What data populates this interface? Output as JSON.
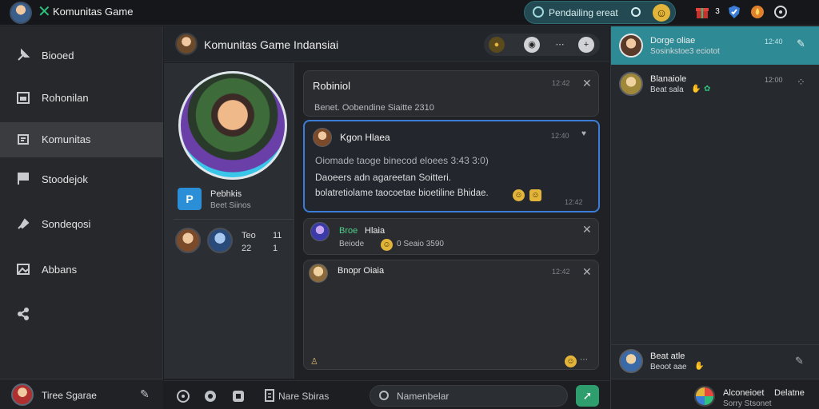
{
  "app": {
    "title": "Komunitas Game"
  },
  "topbar": {
    "search_text": "Pendailing ereat",
    "icons": [
      "avatar-icon",
      "x-logo-icon",
      "search-icon",
      "emoji-icon",
      "gift-icon",
      "notification-count-icon",
      "shield-icon",
      "fire-icon",
      "settings-icon"
    ],
    "badge_count": "3"
  },
  "sidebar": {
    "items": [
      {
        "label": "Biooed",
        "icon": "pin-icon"
      },
      {
        "label": "Rohonilan",
        "icon": "calendar-icon"
      },
      {
        "label": "Komunitas",
        "icon": "community-icon"
      },
      {
        "label": "Stoodejok",
        "icon": "flag-icon"
      },
      {
        "label": "Sondeqosi",
        "icon": "tag-icon"
      },
      {
        "label": "Abbans",
        "icon": "image-icon"
      },
      {
        "label": "",
        "icon": "share-icon"
      }
    ],
    "user": {
      "name": "Tiree Sgarae"
    }
  },
  "chat": {
    "title": "Komunitas Game Indansiai",
    "profile": {
      "badge": "P",
      "name": "Pebhkis",
      "subtitle": "Beet Siinos",
      "stat1_label": "Teo",
      "stat1_value": "22",
      "stat2_label": "11",
      "stat2_value": "1"
    },
    "messages": [
      {
        "title": "Robiniol",
        "meta": "12:42",
        "subtitle": "Benet. Oobendine Siaitte 2310"
      },
      {
        "author": "Kgon Hlaea",
        "meta": "12:40",
        "line1": "Oiomade taoge binecod eloees 3:43 3:0)",
        "line2": "Daoeers adn agareetan Soitteri.",
        "line3": "bolatretiolame taocoetae bioetiline Bhidae.",
        "footer_meta": "12:42"
      },
      {
        "author": "Broe",
        "author2": "Hlaia",
        "subtitle": "Beiode",
        "meta": "0 Seaio 3590"
      },
      {
        "author": "Bnopr Oiaia",
        "meta": "12:42"
      }
    ]
  },
  "composer": {
    "label": "Nare Sbiras",
    "placeholder": "Namenbelar"
  },
  "right_panel": {
    "items": [
      {
        "name": "Dorge oliae",
        "preview": "Sosinkstoe3 eciotot",
        "time": "12:40",
        "action": "pen-icon"
      },
      {
        "name": "Blanaiole",
        "preview": "Beat sala",
        "time": "12:00",
        "action": "more-icon"
      }
    ],
    "bottom_item": {
      "name": "Beat atle",
      "preview": "Beoot aae"
    },
    "footer": {
      "name": "Alconeioet",
      "subtitle": "Sorry Stsonet",
      "name2": "Delatne"
    }
  },
  "colors": {
    "accent_teal": "#2e8a94",
    "accent_blue": "#3b7dd8",
    "send_green": "#2f9e6e",
    "logo_green": "#2ec27e",
    "emoji_yellow": "#e2b53a"
  }
}
